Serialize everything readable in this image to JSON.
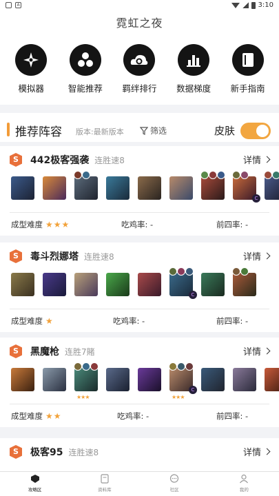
{
  "status_bar": {
    "time": "3:10",
    "icons": [
      "notification-icon",
      "a-icon"
    ]
  },
  "app": {
    "title": "霓虹之夜"
  },
  "quick_nav": [
    {
      "label": "模拟器",
      "icon": "shuriken-icon"
    },
    {
      "label": "智能推荐",
      "icon": "cluster-icon"
    },
    {
      "label": "羁绊排行",
      "icon": "cloud-swirl-icon"
    },
    {
      "label": "数据梯度",
      "icon": "bar-chart-icon"
    },
    {
      "label": "新手指南",
      "icon": "book-icon"
    }
  ],
  "section": {
    "title": "推荐阵容",
    "version": "版本:最新版本",
    "filter_label": "筛选",
    "skin_label": "皮肤",
    "skin_toggle": "on"
  },
  "comps": [
    {
      "badge": "S",
      "name": "442极客强袭",
      "streak": "连胜速8",
      "detail": "详情",
      "difficulty_label": "成型难度",
      "difficulty_stars": "★★★",
      "win_label": "吃鸡率: -",
      "top4_label": "前四率: -"
    },
    {
      "badge": "S",
      "name": "毒斗烈娜塔",
      "streak": "连胜速8",
      "detail": "详情",
      "difficulty_label": "成型难度",
      "difficulty_stars": "★",
      "win_label": "吃鸡率: -",
      "top4_label": "前四率: -"
    },
    {
      "badge": "S",
      "name": "黑魔枪",
      "streak": "连胜7賭",
      "detail": "详情",
      "difficulty_label": "成型难度",
      "difficulty_stars": "★★",
      "win_label": "吃鸡率: -",
      "top4_label": "前四率: -"
    },
    {
      "badge": "S",
      "name": "极客95",
      "streak": "连胜速8",
      "detail": "详情"
    }
  ],
  "tabs": [
    {
      "label": "攻略区",
      "icon": "shield-icon",
      "active": true
    },
    {
      "label": "资料库",
      "icon": "database-icon",
      "active": false
    },
    {
      "label": "社区",
      "icon": "chat-icon",
      "active": false
    },
    {
      "label": "我的",
      "icon": "profile-icon",
      "active": false
    }
  ]
}
